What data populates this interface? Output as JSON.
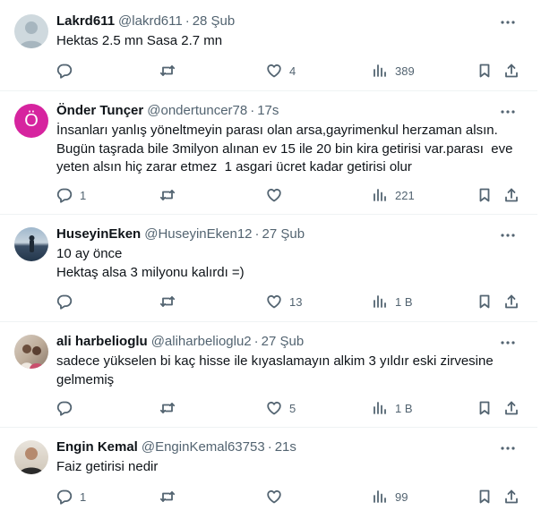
{
  "tweets": [
    {
      "name": "Lakrd611",
      "handle": "@lakrd611",
      "time": "28 Şub",
      "text": "Hektas 2.5 mn Sasa 2.7 mn",
      "replies": "",
      "reposts": "",
      "likes": "4",
      "views": "389",
      "avatar_type": "default-avatar",
      "avatar_initial": ""
    },
    {
      "name": "Önder Tunçer",
      "handle": "@ondertuncer78",
      "time": "17s",
      "text": "İnsanları yanlış yöneltmeyin parası olan arsa,gayrimenkul herzaman alsın. Bugün taşrada bile 3milyon alınan ev 15 ile 20 bin kira getirisi var.parası  eve yeten alsın hiç zarar etmez  1 asgari ücret kadar getirisi olur",
      "replies": "1",
      "reposts": "",
      "likes": "",
      "views": "221",
      "avatar_type": "letter-avatar",
      "avatar_initial": "Ö"
    },
    {
      "name": "HuseyinEken",
      "handle": "@HuseyinEken12",
      "time": "27 Şub",
      "text": "10 ay önce\nHektaş alsa 3 milyonu kalırdı =)",
      "replies": "",
      "reposts": "",
      "likes": "13",
      "views": "1 B",
      "avatar_type": "photo-lake",
      "avatar_initial": ""
    },
    {
      "name": "ali harbelioglu",
      "handle": "@aliharbelioglu2",
      "time": "27 Şub",
      "text": "sadece yükselen bi kaç hisse ile kıyaslamayın alkim 3 yıldır eski zirvesine gelmemiş",
      "replies": "",
      "reposts": "",
      "likes": "5",
      "views": "1 B",
      "avatar_type": "photo-people",
      "avatar_initial": ""
    },
    {
      "name": "Engin Kemal",
      "handle": "@EnginKemal63753",
      "time": "21s",
      "text": "Faiz getirisi nedir",
      "replies": "1",
      "reposts": "",
      "likes": "",
      "views": "99",
      "avatar_type": "photo-man",
      "avatar_initial": ""
    }
  ],
  "separator": "·",
  "colors": {
    "text": "#0f1419",
    "secondary": "#536471",
    "border": "#eff3f4",
    "letter_avatar_bg": "#d6249f"
  }
}
